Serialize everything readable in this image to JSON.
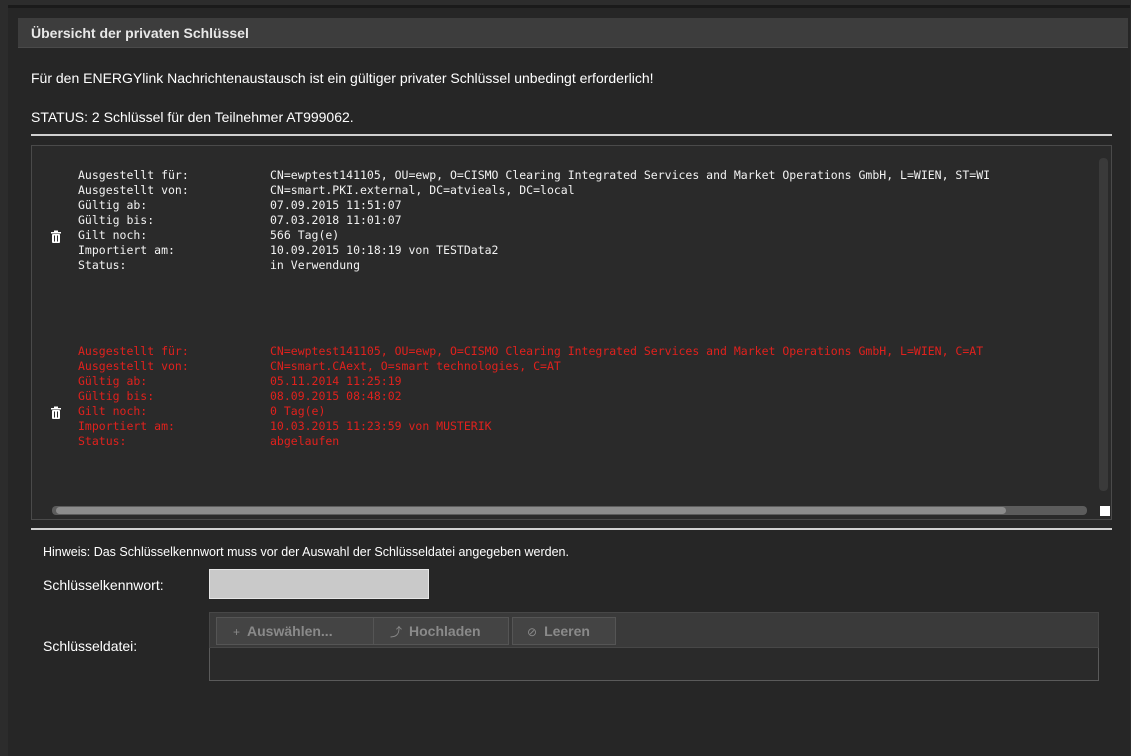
{
  "panel": {
    "title": "Übersicht der privaten Schlüssel"
  },
  "intro_text": "Für den ENERGYlink Nachrichtenaustausch ist ein gültiger privater Schlüssel unbedingt erforderlich!",
  "status_text": "STATUS: 2 Schlüssel für den Teilnehmer AT999062.",
  "keys": [
    {
      "state": "active",
      "rows": [
        {
          "label": "Ausgestellt für:",
          "value": "CN=ewptest141105, OU=ewp, O=CISMO Clearing Integrated Services and Market Operations GmbH, L=WIEN, ST=WI"
        },
        {
          "label": "Ausgestellt von:",
          "value": "CN=smart.PKI.external, DC=atvieals, DC=local"
        },
        {
          "label": "Gültig ab:",
          "value": "07.09.2015 11:51:07"
        },
        {
          "label": "Gültig bis:",
          "value": "07.03.2018 11:01:07"
        },
        {
          "label": "Gilt noch:",
          "value": "566 Tag(e)"
        },
        {
          "label": "Importiert am:",
          "value": "10.09.2015 10:18:19 von TESTData2"
        },
        {
          "label": "Status:",
          "value": "in Verwendung"
        }
      ]
    },
    {
      "state": "expired",
      "rows": [
        {
          "label": "Ausgestellt für:",
          "value": "CN=ewptest141105, OU=ewp, O=CISMO Clearing Integrated Services and Market Operations GmbH, L=WIEN, C=AT"
        },
        {
          "label": "Ausgestellt von:",
          "value": "CN=smart.CAext, O=smart technologies, C=AT"
        },
        {
          "label": "Gültig ab:",
          "value": "05.11.2014 11:25:19"
        },
        {
          "label": "Gültig bis:",
          "value": "08.09.2015 08:48:02"
        },
        {
          "label": "Gilt noch:",
          "value": "0 Tag(e)"
        },
        {
          "label": "Importiert am:",
          "value": "10.03.2015 11:23:59 von MUSTERIK"
        },
        {
          "label": "Status:",
          "value": "abgelaufen"
        }
      ]
    }
  ],
  "hint_text": "Hinweis: Das Schlüsselkennwort muss vor der Auswahl der Schlüsseldatei angegeben werden.",
  "password": {
    "label": "Schlüsselkennwort:",
    "value": ""
  },
  "file": {
    "label": "Schlüsseldatei:",
    "buttons": [
      {
        "icon": "+",
        "label": "Auswählen..."
      },
      {
        "icon": "⤴",
        "label": "Hochladen"
      },
      {
        "icon": "⊘",
        "label": "Leeren"
      }
    ]
  },
  "colors": {
    "background": "#262626",
    "expired_text": "#e0211d",
    "active_text": "#f2f2f2",
    "disabled_button_text": "#8a8a8a"
  },
  "icons": {
    "delete": "trash-icon",
    "select": "plus-icon",
    "upload": "upload-icon",
    "clear": "clear-icon"
  }
}
